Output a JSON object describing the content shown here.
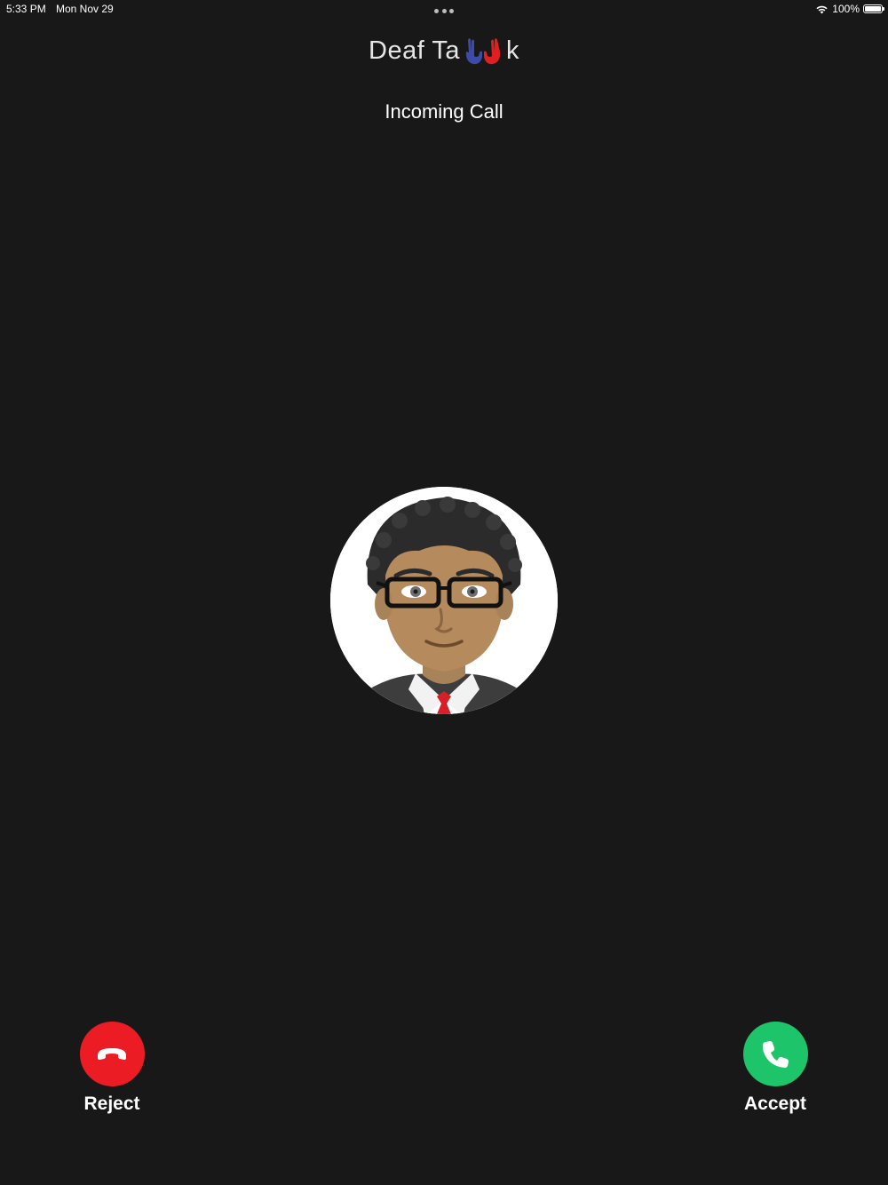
{
  "status_bar": {
    "time": "5:33 PM",
    "date": "Mon Nov 29",
    "battery": "100%",
    "battery_level": 1.0,
    "icons": [
      "multitasking-dots-icon",
      "wifi-icon",
      "battery-icon"
    ]
  },
  "logo": {
    "text_before": "Deaf Ta",
    "text_after": "k",
    "hands_icon": "signing-hands-icon",
    "colors": {
      "left_hand": "#3c4aa8",
      "right_hand": "#e02020"
    }
  },
  "title": "Incoming Call",
  "caller": {
    "avatar_icon": "caller-avatar-icon"
  },
  "actions": {
    "reject": {
      "label": "Reject",
      "icon": "hang-up-phone-icon",
      "color": "#ec1c24"
    },
    "accept": {
      "label": "Accept",
      "icon": "phone-icon",
      "color": "#1ec46a"
    }
  },
  "colors": {
    "background": "#181818",
    "text": "#ffffff"
  }
}
